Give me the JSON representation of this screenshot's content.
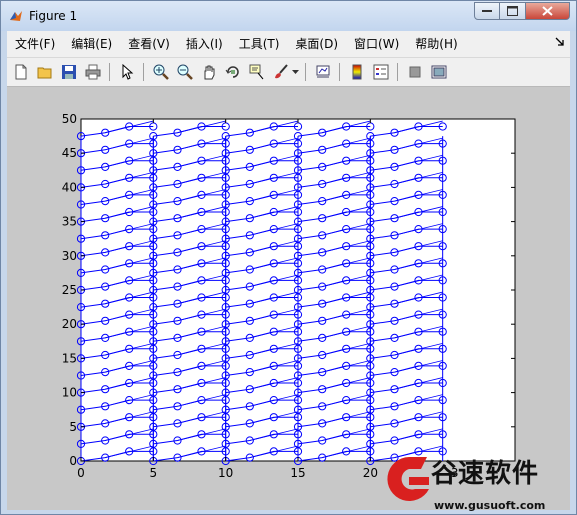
{
  "window": {
    "title": "Figure 1",
    "buttons": {
      "minimize": "–",
      "maximize": "□",
      "close": "✕"
    }
  },
  "menubar": {
    "items": [
      "文件(F)",
      "编辑(E)",
      "查看(V)",
      "插入(I)",
      "工具(T)",
      "桌面(D)",
      "窗口(W)",
      "帮助(H)"
    ],
    "overflow_icon": "dock-arrow-icon"
  },
  "toolbar": {
    "icons": [
      "new-figure-icon",
      "open-file-icon",
      "save-icon",
      "print-icon",
      "pointer-icon",
      "zoom-in-icon",
      "zoom-out-icon",
      "pan-icon",
      "rotate-3d-icon",
      "data-cursor-icon",
      "brush-icon",
      "link-plot-icon",
      "colorbar-icon",
      "legend-icon",
      "hide-plot-tools-icon",
      "show-plot-tools-icon"
    ]
  },
  "chart_data": {
    "type": "line",
    "title": "",
    "xlabel": "",
    "ylabel": "",
    "xlim": [
      0,
      30
    ],
    "ylim": [
      0,
      50
    ],
    "xticks": [
      "0",
      "5",
      "10",
      "15",
      "20"
    ],
    "yticks": [
      "0",
      "5",
      "10",
      "15",
      "20",
      "25",
      "30",
      "35",
      "40",
      "45",
      "50"
    ],
    "last_xtick_partial": "3",
    "marker": "circle",
    "line_color": "#0000ff",
    "grid": false,
    "x_groups": [
      [
        0,
        1.67,
        3.33,
        5
      ],
      [
        5,
        6.67,
        8.33,
        10
      ],
      [
        10,
        11.67,
        13.33,
        15
      ],
      [
        15,
        16.67,
        18.33,
        20
      ],
      [
        20,
        21.67,
        23.33,
        25
      ]
    ],
    "y_levels": [
      0,
      2.5,
      5,
      7.5,
      10,
      12.5,
      15,
      17.5,
      20,
      22.5,
      25,
      27.5,
      30,
      32.5,
      35,
      37.5,
      40,
      42.5,
      45,
      47.5
    ]
  },
  "watermark": {
    "brand": "谷速软件",
    "url": "www.gusuoft.com",
    "colors": {
      "red": "#d9201f",
      "black": "#111111"
    }
  }
}
